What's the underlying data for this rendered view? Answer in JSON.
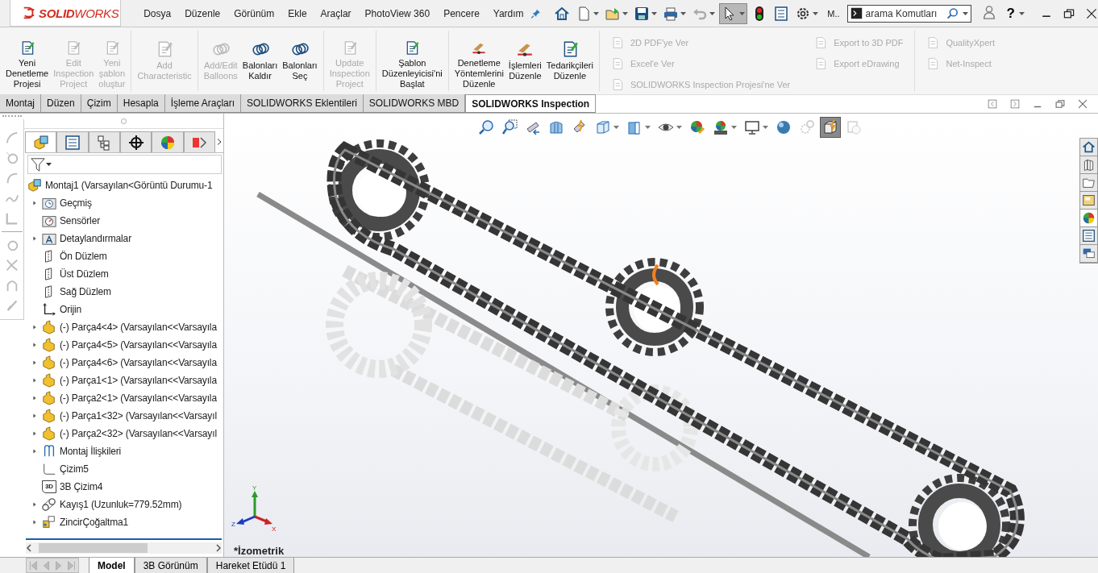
{
  "logo": "**SOLID**WORKS",
  "menu": [
    "Dosya",
    "Düzenle",
    "Görünüm",
    "Ekle",
    "Araçlar",
    "PhotoView 360",
    "Pencere",
    "Yardım"
  ],
  "quick_toolbar": [
    {
      "kind": "home",
      "dropdown": false,
      "disabled": false,
      "pressed": false
    },
    {
      "kind": "new",
      "dropdown": true,
      "disabled": false,
      "pressed": false
    },
    {
      "kind": "open",
      "dropdown": true,
      "disabled": false,
      "pressed": false
    },
    {
      "kind": "save",
      "dropdown": true,
      "disabled": false,
      "pressed": false
    },
    {
      "kind": "print",
      "dropdown": true,
      "disabled": false,
      "pressed": false
    },
    {
      "kind": "undo",
      "dropdown": true,
      "disabled": true,
      "pressed": false
    },
    {
      "kind": "select",
      "dropdown": true,
      "disabled": false,
      "pressed": true
    },
    {
      "kind": "rebuild",
      "dropdown": false,
      "disabled": false,
      "pressed": false
    },
    {
      "kind": "properties",
      "dropdown": false,
      "disabled": false,
      "pressed": false
    },
    {
      "kind": "options",
      "dropdown": true,
      "disabled": false,
      "pressed": false
    }
  ],
  "macro_label": "M..",
  "search": {
    "placeholder": "arama Komutları"
  },
  "help": "?",
  "ribbon": {
    "groups": [
      {
        "kind": "large",
        "buttons": [
          {
            "label": "Yeni\nDenetleme\nProjesi",
            "disabled": false
          },
          {
            "label": "Edit\nInspection\nProject",
            "disabled": true
          },
          {
            "label": "Yeni\nşablon\noluştur",
            "disabled": true
          }
        ]
      },
      {
        "kind": "large",
        "buttons": [
          {
            "label": "Add\nCharacteristic",
            "disabled": true
          }
        ]
      },
      {
        "kind": "large",
        "buttons": [
          {
            "label": "Add/Edit\nBalloons",
            "disabled": true
          },
          {
            "label": "Balonları\nKaldır",
            "disabled": false
          },
          {
            "label": "Balonları\nSeç",
            "disabled": false
          }
        ]
      },
      {
        "kind": "large",
        "buttons": [
          {
            "label": "Update\nInspection\nProject",
            "disabled": true
          }
        ]
      },
      {
        "kind": "large",
        "buttons": [
          {
            "label": "Şablon\nDüzenleyicisi'ni\nBaşlat",
            "disabled": false
          }
        ]
      },
      {
        "kind": "large",
        "buttons": [
          {
            "label": "Denetleme\nYöntemlerini\nDüzenle",
            "disabled": false
          },
          {
            "label": "İşlemleri\nDüzenle",
            "disabled": false
          },
          {
            "label": "Tedarikçileri\nDüzenle",
            "disabled": false
          }
        ]
      },
      {
        "kind": "small",
        "columns": [
          [
            {
              "label": "2D PDF'ye Ver",
              "disabled": true
            },
            {
              "label": "Excel'e Ver",
              "disabled": true
            },
            {
              "label": "SOLIDWORKS Inspection Projesi'ne Ver",
              "disabled": true
            }
          ],
          [
            {
              "label": "Export to 3D PDF",
              "disabled": true
            },
            {
              "label": "Export eDrawing",
              "disabled": true
            }
          ]
        ]
      },
      {
        "kind": "small",
        "columns": [
          [
            {
              "label": "QualityXpert",
              "disabled": true
            },
            {
              "label": "Net-Inspect",
              "disabled": true
            }
          ]
        ]
      }
    ]
  },
  "command_tabs": [
    {
      "label": "Montaj",
      "selected": false
    },
    {
      "label": "Düzen",
      "selected": false
    },
    {
      "label": "Çizim",
      "selected": false
    },
    {
      "label": "Hesapla",
      "selected": false
    },
    {
      "label": "İşleme Araçları",
      "selected": false
    },
    {
      "label": "SOLIDWORKS Eklentileri",
      "selected": false
    },
    {
      "label": "SOLIDWORKS MBD",
      "selected": false
    },
    {
      "label": "SOLIDWORKS Inspection",
      "selected": true
    }
  ],
  "panel_tabs": [
    {
      "kind": "feature",
      "selected": true
    },
    {
      "kind": "property",
      "selected": false
    },
    {
      "kind": "configuration",
      "selected": false
    },
    {
      "kind": "target",
      "selected": false
    },
    {
      "kind": "appearance",
      "selected": false
    },
    {
      "kind": "cam",
      "selected": false
    }
  ],
  "tree": {
    "root": {
      "label": "Montaj1 (Varsayılan<Görüntü Durumu-1",
      "kind": "assembly",
      "children": [
        {
          "label": "Geçmiş",
          "kind": "history",
          "collapsed": true
        },
        {
          "label": "Sensörler",
          "kind": "sensor",
          "collapsed": false
        },
        {
          "label": "Detaylandırmalar",
          "kind": "annotation",
          "collapsed": true
        },
        {
          "label": "Ön Düzlem",
          "kind": "plane",
          "collapsed": false
        },
        {
          "label": "Üst Düzlem",
          "kind": "plane",
          "collapsed": false
        },
        {
          "label": "Sağ Düzlem",
          "kind": "plane",
          "collapsed": false
        },
        {
          "label": "Orijin",
          "kind": "origin",
          "collapsed": false
        },
        {
          "label": "(-) Parça4<4> (Varsayılan<<Varsayıla",
          "kind": "part",
          "collapsed": true
        },
        {
          "label": "(-) Parça4<5> (Varsayılan<<Varsayıla",
          "kind": "part",
          "collapsed": true
        },
        {
          "label": "(-) Parça4<6> (Varsayılan<<Varsayıla",
          "kind": "part",
          "collapsed": true
        },
        {
          "label": "(-) Parça1<1> (Varsayılan<<Varsayıla",
          "kind": "part",
          "collapsed": true
        },
        {
          "label": "(-) Parça2<1> (Varsayılan<<Varsayıla",
          "kind": "part",
          "collapsed": true
        },
        {
          "label": "(-) Parça1<32> (Varsayılan<<Varsayıl",
          "kind": "part",
          "collapsed": true
        },
        {
          "label": "(-) Parça2<32> (Varsayılan<<Varsayıl",
          "kind": "part",
          "collapsed": true
        },
        {
          "label": "Montaj İlişkileri",
          "kind": "mates",
          "collapsed": true
        },
        {
          "label": "Çizim5",
          "kind": "sketch",
          "collapsed": false
        },
        {
          "label": "3B Çizim4",
          "kind": "sketch3d",
          "icon_text": "3D",
          "collapsed": false
        },
        {
          "label": "Kayış1 (Uzunluk=779.52mm)",
          "kind": "belt",
          "collapsed": true
        },
        {
          "label": "ZincirÇoğaltma1",
          "kind": "pattern",
          "collapsed": true
        }
      ]
    }
  },
  "view_toolbar": [
    {
      "kind": "zoom-fit",
      "dropdown": false,
      "pressed": false,
      "disabled": false
    },
    {
      "kind": "zoom-area",
      "dropdown": false,
      "pressed": false,
      "disabled": false
    },
    {
      "kind": "previous",
      "dropdown": false,
      "pressed": false,
      "disabled": false
    },
    {
      "kind": "section",
      "dropdown": false,
      "pressed": false,
      "disabled": false
    },
    {
      "kind": "annotation",
      "dropdown": false,
      "pressed": false,
      "disabled": false
    },
    {
      "kind": "orientation",
      "dropdown": true,
      "pressed": false,
      "disabled": false
    },
    {
      "kind": "display",
      "dropdown": true,
      "pressed": false,
      "disabled": false
    },
    {
      "kind": "hide",
      "dropdown": true,
      "pressed": false,
      "disabled": false
    },
    {
      "kind": "appearance",
      "dropdown": false,
      "pressed": false,
      "disabled": false
    },
    {
      "kind": "scene",
      "dropdown": true,
      "pressed": false,
      "disabled": false
    },
    {
      "kind": "monitor",
      "dropdown": true,
      "pressed": false,
      "disabled": false
    },
    {
      "kind": "sphere",
      "dropdown": false,
      "pressed": false,
      "disabled": false
    },
    {
      "kind": "gears",
      "dropdown": false,
      "pressed": false,
      "disabled": true
    },
    {
      "kind": "instant",
      "dropdown": false,
      "pressed": true,
      "disabled": false
    },
    {
      "kind": "cube",
      "dropdown": false,
      "pressed": false,
      "disabled": true
    }
  ],
  "task_pane": [
    {
      "selected": false
    },
    {
      "selected": false
    },
    {
      "selected": false
    },
    {
      "selected": false
    },
    {
      "selected": true
    },
    {
      "selected": false
    },
    {
      "selected": false
    }
  ],
  "view_label": "*İzometrik",
  "triad": {
    "x": "X",
    "y": "Y",
    "z": "Z"
  },
  "bottom_tabs": [
    {
      "label": "Model",
      "selected": true
    },
    {
      "label": "3B Görünüm",
      "selected": false
    },
    {
      "label": "Hareket Etüdü 1",
      "selected": false
    }
  ]
}
